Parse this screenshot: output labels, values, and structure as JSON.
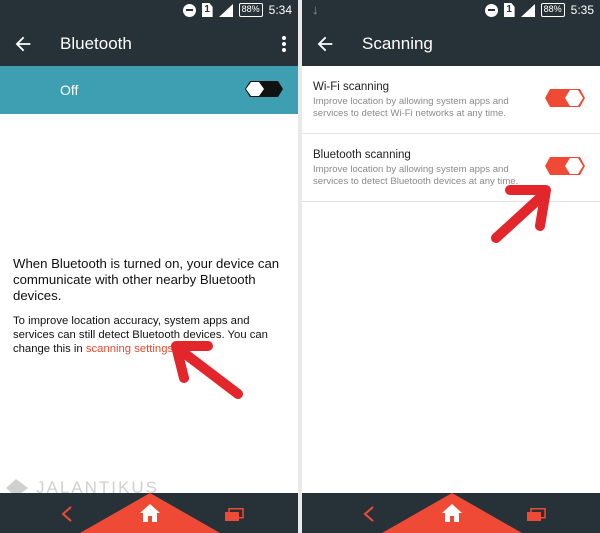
{
  "colors": {
    "toolbar": "#263238",
    "switch_bar": "#3f9fb2",
    "accent": "#ef4a35",
    "link": "#e64a2f"
  },
  "left": {
    "status": {
      "battery": "88%",
      "time": "5:34",
      "sim": "1"
    },
    "appbar": {
      "title": "Bluetooth"
    },
    "switch_bar": {
      "label": "Off",
      "toggle_state": "off"
    },
    "content": {
      "main_text": "When Bluetooth is turned on, your device can communicate with other nearby Bluetooth devices.",
      "sub_text_prefix": "To improve location accuracy, system apps and services can still detect Bluetooth devices. You can change this in ",
      "link_text": "scanning settings",
      "sub_text_suffix": "."
    }
  },
  "right": {
    "status": {
      "battery": "88%",
      "time": "5:35",
      "sim": "1"
    },
    "appbar": {
      "title": "Scanning"
    },
    "settings": [
      {
        "title": "Wi-Fi scanning",
        "summary": "Improve location by allowing system apps and services to detect Wi-Fi networks at any time.",
        "toggle_state": "on"
      },
      {
        "title": "Bluetooth scanning",
        "summary": "Improve location by allowing system apps and services to detect Bluetooth devices at any time.",
        "toggle_state": "on"
      }
    ]
  },
  "icons": {
    "back": "arrow-left-icon",
    "more": "more-vert-icon",
    "nav_back": "chevron-left-icon",
    "nav_home": "home-icon",
    "nav_recent": "recent-apps-icon",
    "annotation": "red-arrow-icon"
  }
}
